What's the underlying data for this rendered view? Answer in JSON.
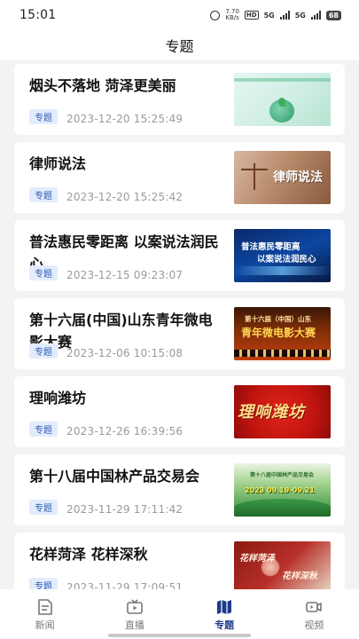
{
  "status_bar": {
    "time": "15:01",
    "speed_value": "7.70",
    "speed_unit": "KB/s",
    "hd": "HD",
    "network1": "5G",
    "network2": "5G",
    "battery": "68"
  },
  "header": {
    "title": "专题"
  },
  "topics": [
    {
      "title": "烟头不落地 菏泽更美丽",
      "tag": "专题",
      "time": "2023-12-20 15:25:49"
    },
    {
      "title": "律师说法",
      "tag": "专题",
      "time": "2023-12-20 15:25:42",
      "thumb_text": "律师说法"
    },
    {
      "title": "普法惠民零距离 以案说法润民心",
      "tag": "专题",
      "time": "2023-12-15 09:23:07",
      "thumb_text": [
        "普法惠民零距离",
        "以案说法润民心"
      ]
    },
    {
      "title": "第十六届(中国)山东青年微电影大赛",
      "tag": "专题",
      "time": "2023-12-06 10:15:08",
      "thumb_text": [
        "第十六届（中国）山东",
        "青年微电影大赛"
      ]
    },
    {
      "title": "理响潍坊",
      "tag": "专题",
      "time": "2023-12-26 16:39:56",
      "thumb_text": "理响潍坊"
    },
    {
      "title": "第十八届中国林产品交易会",
      "tag": "专题",
      "time": "2023-11-29 17:11:42",
      "thumb_text": [
        "第十八届中国林产品交易会",
        "2023 09.19-09.21"
      ]
    },
    {
      "title": "花样菏泽 花样深秋",
      "tag": "专题",
      "time": "2023-11-29 17:09:51",
      "thumb_text": [
        "花样菏泽",
        "花样深秋"
      ]
    }
  ],
  "tabbar": [
    {
      "label": "新闻",
      "icon": "news-icon",
      "active": false
    },
    {
      "label": "直播",
      "icon": "live-tv-icon",
      "active": false
    },
    {
      "label": "专题",
      "icon": "topic-map-icon",
      "active": true
    },
    {
      "label": "视频",
      "icon": "video-camera-icon",
      "active": false
    }
  ],
  "colors": {
    "accent": "#1e3a8a",
    "tag_bg": "#e3ecfb",
    "tag_text": "#2d5db8",
    "background": "#f2f3f5"
  }
}
